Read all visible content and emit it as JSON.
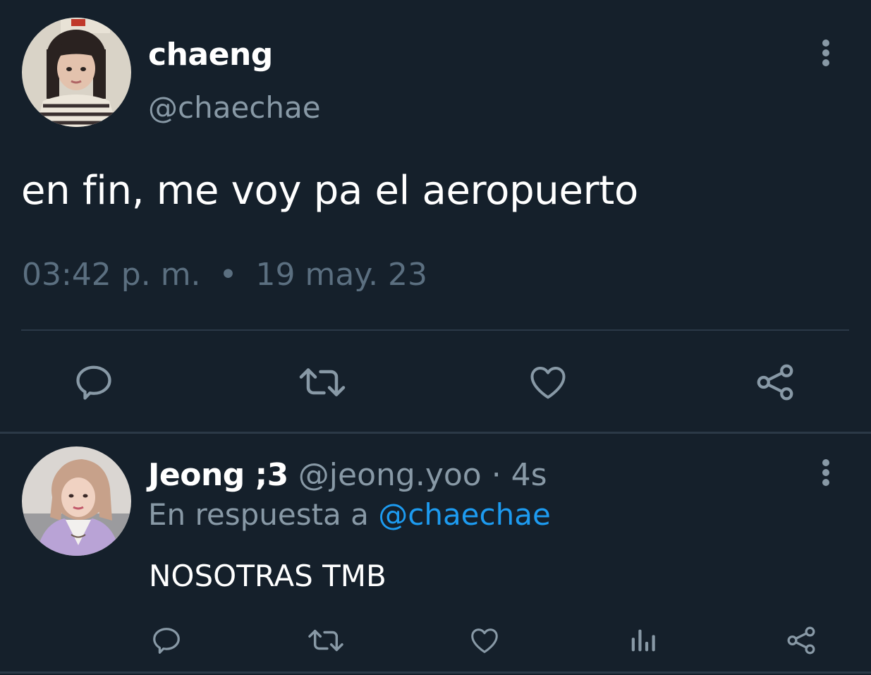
{
  "main_tweet": {
    "author": {
      "display_name": "chaeng",
      "handle": "@chaechae"
    },
    "text": "en fin, me voy pa el aeropuerto",
    "time": "03:42 p. m.",
    "separator": "•",
    "date": "19 may. 23",
    "actions": [
      {
        "icon": "reply-icon"
      },
      {
        "icon": "retweet-icon"
      },
      {
        "icon": "like-icon"
      },
      {
        "icon": "share-icon"
      }
    ]
  },
  "reply": {
    "author": {
      "display_name": "Jeong ;3",
      "handle": "@jeong.yoo"
    },
    "time": "· 4s",
    "in_reply_to_prefix": "En respuesta a",
    "in_reply_to_handle": "@chaechae",
    "text": "NOSOTRAS TMB",
    "actions": [
      {
        "icon": "reply-icon"
      },
      {
        "icon": "retweet-icon"
      },
      {
        "icon": "like-icon"
      },
      {
        "icon": "analytics-icon"
      },
      {
        "icon": "share-icon"
      }
    ]
  },
  "colors": {
    "background": "#15202b",
    "primary_text": "#ffffff",
    "secondary_text": "#8899a6",
    "meta_text": "#5b6f80",
    "link": "#1d9bf0",
    "divider": "#2b3947",
    "icon": "#8899a6"
  }
}
